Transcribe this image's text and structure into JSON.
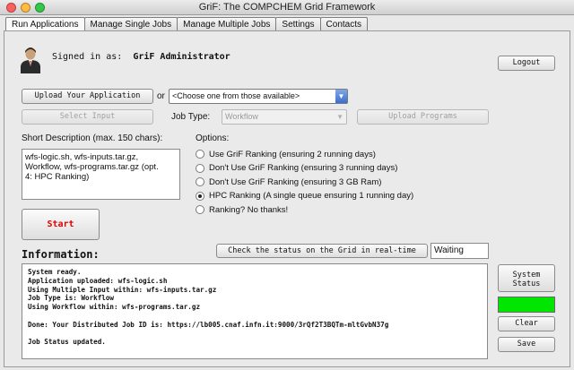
{
  "window": {
    "title": "GriF: The COMPCHEM Grid Framework"
  },
  "tabs": [
    {
      "label": "Run Applications",
      "active": true
    },
    {
      "label": "Manage Single Jobs"
    },
    {
      "label": "Manage Multiple Jobs"
    },
    {
      "label": "Settings"
    },
    {
      "label": "Contacts"
    }
  ],
  "user": {
    "signed_in_label": "Signed in as:",
    "name": "GriF Administrator",
    "logout": "Logout"
  },
  "upload": {
    "upload_app": "Upload Your Application",
    "or": "or",
    "choose_placeholder": "<Choose one from those available>",
    "select_input": "Select Input",
    "job_type_label": "Job Type:",
    "job_type_value": "Workflow",
    "upload_programs": "Upload Programs"
  },
  "description": {
    "label": "Short Description (max. 150 chars):",
    "text": "wfs-logic.sh, wfs-inputs.tar.gz,\nWorkflow, wfs-programs.tar.gz (opt.\n4: HPC Ranking)"
  },
  "options": {
    "label": "Options:",
    "items": [
      {
        "label": "Use GriF Ranking (ensuring 2 running days)",
        "selected": false
      },
      {
        "label": "Don't Use GriF Ranking (ensuring 3 running days)",
        "selected": false
      },
      {
        "label": "Don't Use GriF Ranking (ensuring 3 GB Ram)",
        "selected": false
      },
      {
        "label": "HPC Ranking (A single queue ensuring 1 running day)",
        "selected": true
      },
      {
        "label": "Ranking? No thanks!",
        "selected": false
      }
    ]
  },
  "start": {
    "label": "Start",
    "color": "#e00000"
  },
  "information": {
    "label": "Information:",
    "check_status": "Check the status on the Grid in real-time",
    "status_value": "Waiting",
    "log": "System ready.\nApplication uploaded: wfs-logic.sh\nUsing Multiple Input within: wfs-inputs.tar.gz\nJob Type is: Workflow\nUsing Workflow within: wfs-programs.tar.gz\n\nDone: Your Distributed Job ID is: https://lb005.cnaf.infn.it:9000/3rQf2T3BQTm-mltGvbN37g\n\nJob Status updated."
  },
  "side": {
    "system_status": "System Status",
    "status_color": "#00e600",
    "clear": "Clear",
    "save": "Save"
  }
}
